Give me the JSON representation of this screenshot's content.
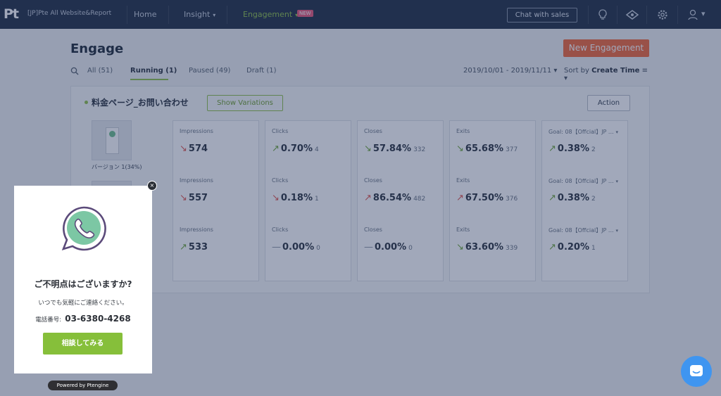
{
  "nav": {
    "logo": "Pt",
    "site": "[JP]Pte All Website&Report",
    "home": "Home",
    "insight": "Insight",
    "engagement": "Engagement",
    "new_badge": "NEW",
    "chat_sales": "Chat with sales",
    "caret": "▾"
  },
  "page": {
    "title": "Engage",
    "new_button": "New Engagement",
    "tabs": [
      "All (51)",
      "Running (1)",
      "Paused (49)",
      "Draft (1)"
    ],
    "date_range": "2019/10/01 - 2019/11/11 ▾",
    "sort_prefix": "Sort by ",
    "sort_field": "Create Time",
    "sort_caret": "≡ ▾"
  },
  "card": {
    "title": "料金ページ_お問い合わせ",
    "show_variations": "Show Variations",
    "action": "Action",
    "variant_label": "バージョン 1(34%)",
    "metrics": [
      {
        "label": "Impressions",
        "rows": [
          {
            "arrow": "↘",
            "trend": "down",
            "value": "574",
            "sub": ""
          },
          {
            "arrow": "↘",
            "trend": "down",
            "value": "557",
            "sub": ""
          },
          {
            "arrow": "↗",
            "trend": "up",
            "value": "533",
            "sub": ""
          }
        ]
      },
      {
        "label": "Clicks",
        "rows": [
          {
            "arrow": "↗",
            "trend": "up",
            "value": "0.70%",
            "sub": "4"
          },
          {
            "arrow": "↘",
            "trend": "down",
            "value": "0.18%",
            "sub": "1"
          },
          {
            "arrow": "—",
            "trend": "flat",
            "value": "0.00%",
            "sub": "0"
          }
        ]
      },
      {
        "label": "Closes",
        "rows": [
          {
            "arrow": "↘",
            "trend": "up",
            "value": "57.84%",
            "sub": "332"
          },
          {
            "arrow": "↗",
            "trend": "down",
            "value": "86.54%",
            "sub": "482"
          },
          {
            "arrow": "—",
            "trend": "flat",
            "value": "0.00%",
            "sub": "0"
          }
        ]
      },
      {
        "label": "Exits",
        "rows": [
          {
            "arrow": "↘",
            "trend": "up",
            "value": "65.68%",
            "sub": "377"
          },
          {
            "arrow": "↗",
            "trend": "down",
            "value": "67.50%",
            "sub": "376"
          },
          {
            "arrow": "↘",
            "trend": "up",
            "value": "63.60%",
            "sub": "339"
          }
        ]
      },
      {
        "label": "Goal: 08【Offcial】JP ...",
        "rows": [
          {
            "arrow": "↗",
            "trend": "up",
            "value": "0.38%",
            "sub": "2"
          },
          {
            "arrow": "↗",
            "trend": "up",
            "value": "0.38%",
            "sub": "2"
          },
          {
            "arrow": "↗",
            "trend": "up",
            "value": "0.20%",
            "sub": "1"
          }
        ]
      }
    ]
  },
  "popup": {
    "title": "ご不明点はございますか?",
    "subtitle": "いつでも気軽にご連絡ください。",
    "phone_label": "電話番号:",
    "phone": "03-6380-4268",
    "button": "相談してみる",
    "powered_by": "Powered by Ptengine",
    "close": "×"
  },
  "colors": {
    "nav_bg": "#243145",
    "accent_green": "#8fc14a",
    "new_engagement": "#f26a3b",
    "trend_down": "#e0564f",
    "trend_up": "#6fa53b",
    "chat_fab": "#3f95f0",
    "overlay": "#1e305a"
  }
}
